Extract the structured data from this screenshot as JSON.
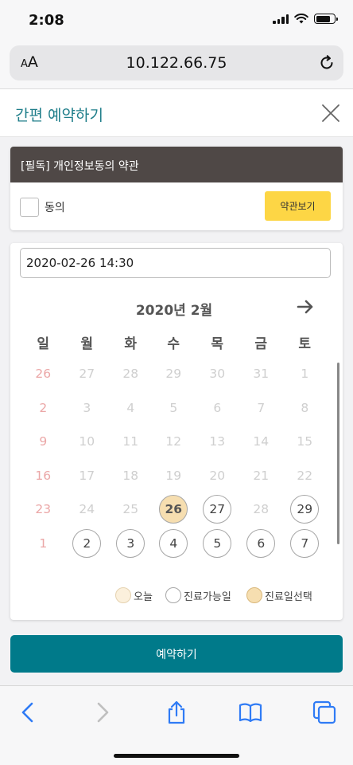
{
  "status_bar": {
    "time": "2:08",
    "icons": [
      "cellular-signal-icon",
      "wifi-icon",
      "battery-icon"
    ]
  },
  "browser": {
    "text_size_label": [
      "A",
      "A"
    ],
    "url": "10.122.66.75",
    "reload_icon": "reload-icon"
  },
  "modal": {
    "title": "간편 예약하기",
    "close_icon": "close-icon"
  },
  "terms": {
    "header": "[필독] 개인정보동의 약관",
    "agree_label": "동의",
    "agreed": false,
    "view_button": "약관보기"
  },
  "booking": {
    "datetime_value": "2020-02-26 14:30",
    "calendar": {
      "month_label": "2020년 2월",
      "next_icon": "arrow-right-icon",
      "weekdays": [
        "일",
        "월",
        "화",
        "수",
        "목",
        "금",
        "토"
      ],
      "weeks": [
        [
          {
            "d": "26",
            "s": "muted"
          },
          {
            "d": "27",
            "s": "muted"
          },
          {
            "d": "28",
            "s": "muted"
          },
          {
            "d": "29",
            "s": "muted"
          },
          {
            "d": "30",
            "s": "muted"
          },
          {
            "d": "31",
            "s": "muted"
          },
          {
            "d": "1",
            "s": "muted"
          }
        ],
        [
          {
            "d": "2",
            "s": "muted"
          },
          {
            "d": "3",
            "s": "muted"
          },
          {
            "d": "4",
            "s": "muted"
          },
          {
            "d": "5",
            "s": "muted"
          },
          {
            "d": "6",
            "s": "muted"
          },
          {
            "d": "7",
            "s": "muted"
          },
          {
            "d": "8",
            "s": "muted"
          }
        ],
        [
          {
            "d": "9",
            "s": "muted"
          },
          {
            "d": "10",
            "s": "muted"
          },
          {
            "d": "11",
            "s": "muted"
          },
          {
            "d": "12",
            "s": "muted"
          },
          {
            "d": "13",
            "s": "muted"
          },
          {
            "d": "14",
            "s": "muted"
          },
          {
            "d": "15",
            "s": "muted"
          }
        ],
        [
          {
            "d": "16",
            "s": "muted"
          },
          {
            "d": "17",
            "s": "muted"
          },
          {
            "d": "18",
            "s": "muted"
          },
          {
            "d": "19",
            "s": "muted"
          },
          {
            "d": "20",
            "s": "muted"
          },
          {
            "d": "21",
            "s": "muted"
          },
          {
            "d": "22",
            "s": "muted"
          }
        ],
        [
          {
            "d": "23",
            "s": "muted"
          },
          {
            "d": "24",
            "s": "muted"
          },
          {
            "d": "25",
            "s": "muted"
          },
          {
            "d": "26",
            "s": "selected"
          },
          {
            "d": "27",
            "s": "available"
          },
          {
            "d": "28",
            "s": "muted"
          },
          {
            "d": "29",
            "s": "available"
          }
        ],
        [
          {
            "d": "1",
            "s": "muted"
          },
          {
            "d": "2",
            "s": "available"
          },
          {
            "d": "3",
            "s": "available"
          },
          {
            "d": "4",
            "s": "available"
          },
          {
            "d": "5",
            "s": "available"
          },
          {
            "d": "6",
            "s": "available"
          },
          {
            "d": "7",
            "s": "available"
          }
        ]
      ]
    },
    "legend": [
      {
        "label": "오늘",
        "color": "#fbf0dc",
        "border": "#e5d2b0"
      },
      {
        "label": "진료가능일",
        "color": "#ffffff",
        "border": "#a6a6a6"
      },
      {
        "label": "진료일선택",
        "color": "#f6deb0",
        "border": "#d9b77a"
      }
    ]
  },
  "submit_button": "예약하기",
  "toolbar": {
    "icons": [
      "back-icon",
      "forward-icon",
      "share-icon",
      "bookmarks-icon",
      "tabs-icon"
    ]
  },
  "colors": {
    "accent": "#007a8a",
    "title_teal": "#1f7e8a",
    "terms_header_bg": "#4f4846",
    "terms_button": "#fdd645",
    "sunday_red": "#eba7a7",
    "selected_day": "#f6deb0"
  }
}
